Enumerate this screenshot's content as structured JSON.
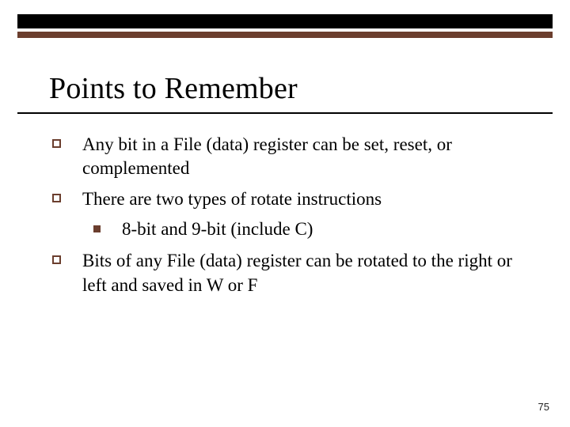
{
  "title": "Points to Remember",
  "bullets": {
    "b1": "Any bit in a File (data) register can be set, reset, or complemented",
    "b2": "There are two types of rotate instructions",
    "b2_sub": "8-bit and 9-bit (include C)",
    "b3": "Bits of any File (data) register can be rotated to the right or left and saved in W or F"
  },
  "page_number": "75"
}
